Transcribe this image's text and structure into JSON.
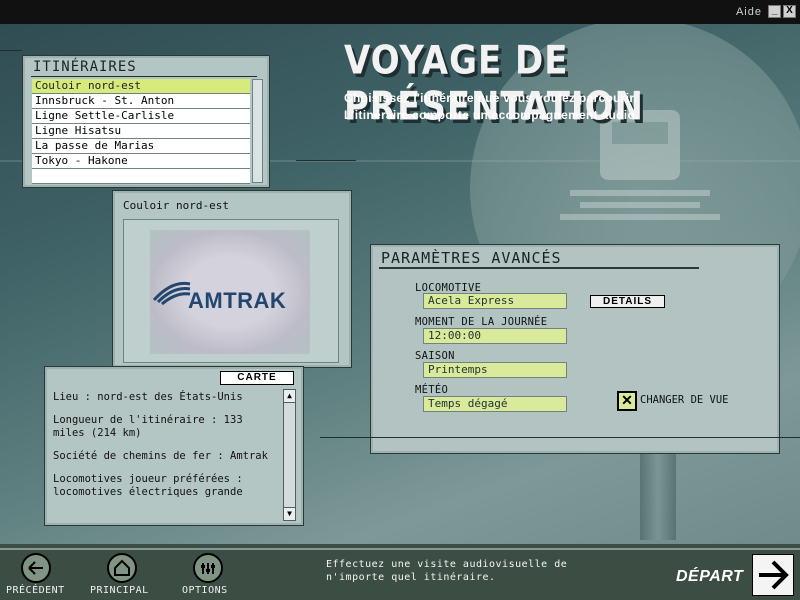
{
  "window": {
    "help_label": "Aide",
    "minimize_label": "_",
    "close_label": "X"
  },
  "header": {
    "title": "VOYAGE DE PRÉSENTATION",
    "subtitle_line1": "Choisissez l'itinéraire que vous voulez parcourir.",
    "subtitle_line2": "L'itinéraire comporte un accompagnement audio."
  },
  "itineraires": {
    "heading": "ITINÉRAIRES",
    "items": [
      "Couloir nord-est",
      "Innsbruck - St. Anton",
      "Ligne Settle-Carlisle",
      "Ligne Hisatsu",
      "La passe de Marias",
      "Tokyo - Hakone"
    ],
    "selected_index": 0
  },
  "preview": {
    "route_name": "Couloir nord-est",
    "logo_text": "AMTRAK"
  },
  "info": {
    "map_button": "CARTE",
    "lines": [
      "Lieu : nord-est des États-Unis",
      "Longueur de l'itinéraire : 133 miles (214 km)",
      "Société de chemins de fer : Amtrak",
      "Locomotives joueur préférées : locomotives électriques grande"
    ]
  },
  "advanced": {
    "heading": "PARAMÈTRES AVANCÉS",
    "locomotive_label": "LOCOMOTIVE",
    "locomotive_value": "Acela Express",
    "details_button": "DETAILS",
    "time_label": "MOMENT DE LA JOURNÉE",
    "time_value": "12:00:00",
    "season_label": "SAISON",
    "season_value": "Printemps",
    "weather_label": "MÉTÉO",
    "weather_value": "Temps dégagé",
    "change_view_label": "CHANGER DE VUE",
    "change_view_checked": true
  },
  "bottom": {
    "prev_label": "PRÉCÉDENT",
    "main_label": "PRINCIPAL",
    "options_label": "OPTIONS",
    "message": "Effectuez une visite audiovisuelle de n'importe quel itinéraire.",
    "depart_label": "DÉPART"
  },
  "colors": {
    "selection": "#d7ea7c",
    "field": "#d9ea9a",
    "panel": "#b4c6c4"
  }
}
